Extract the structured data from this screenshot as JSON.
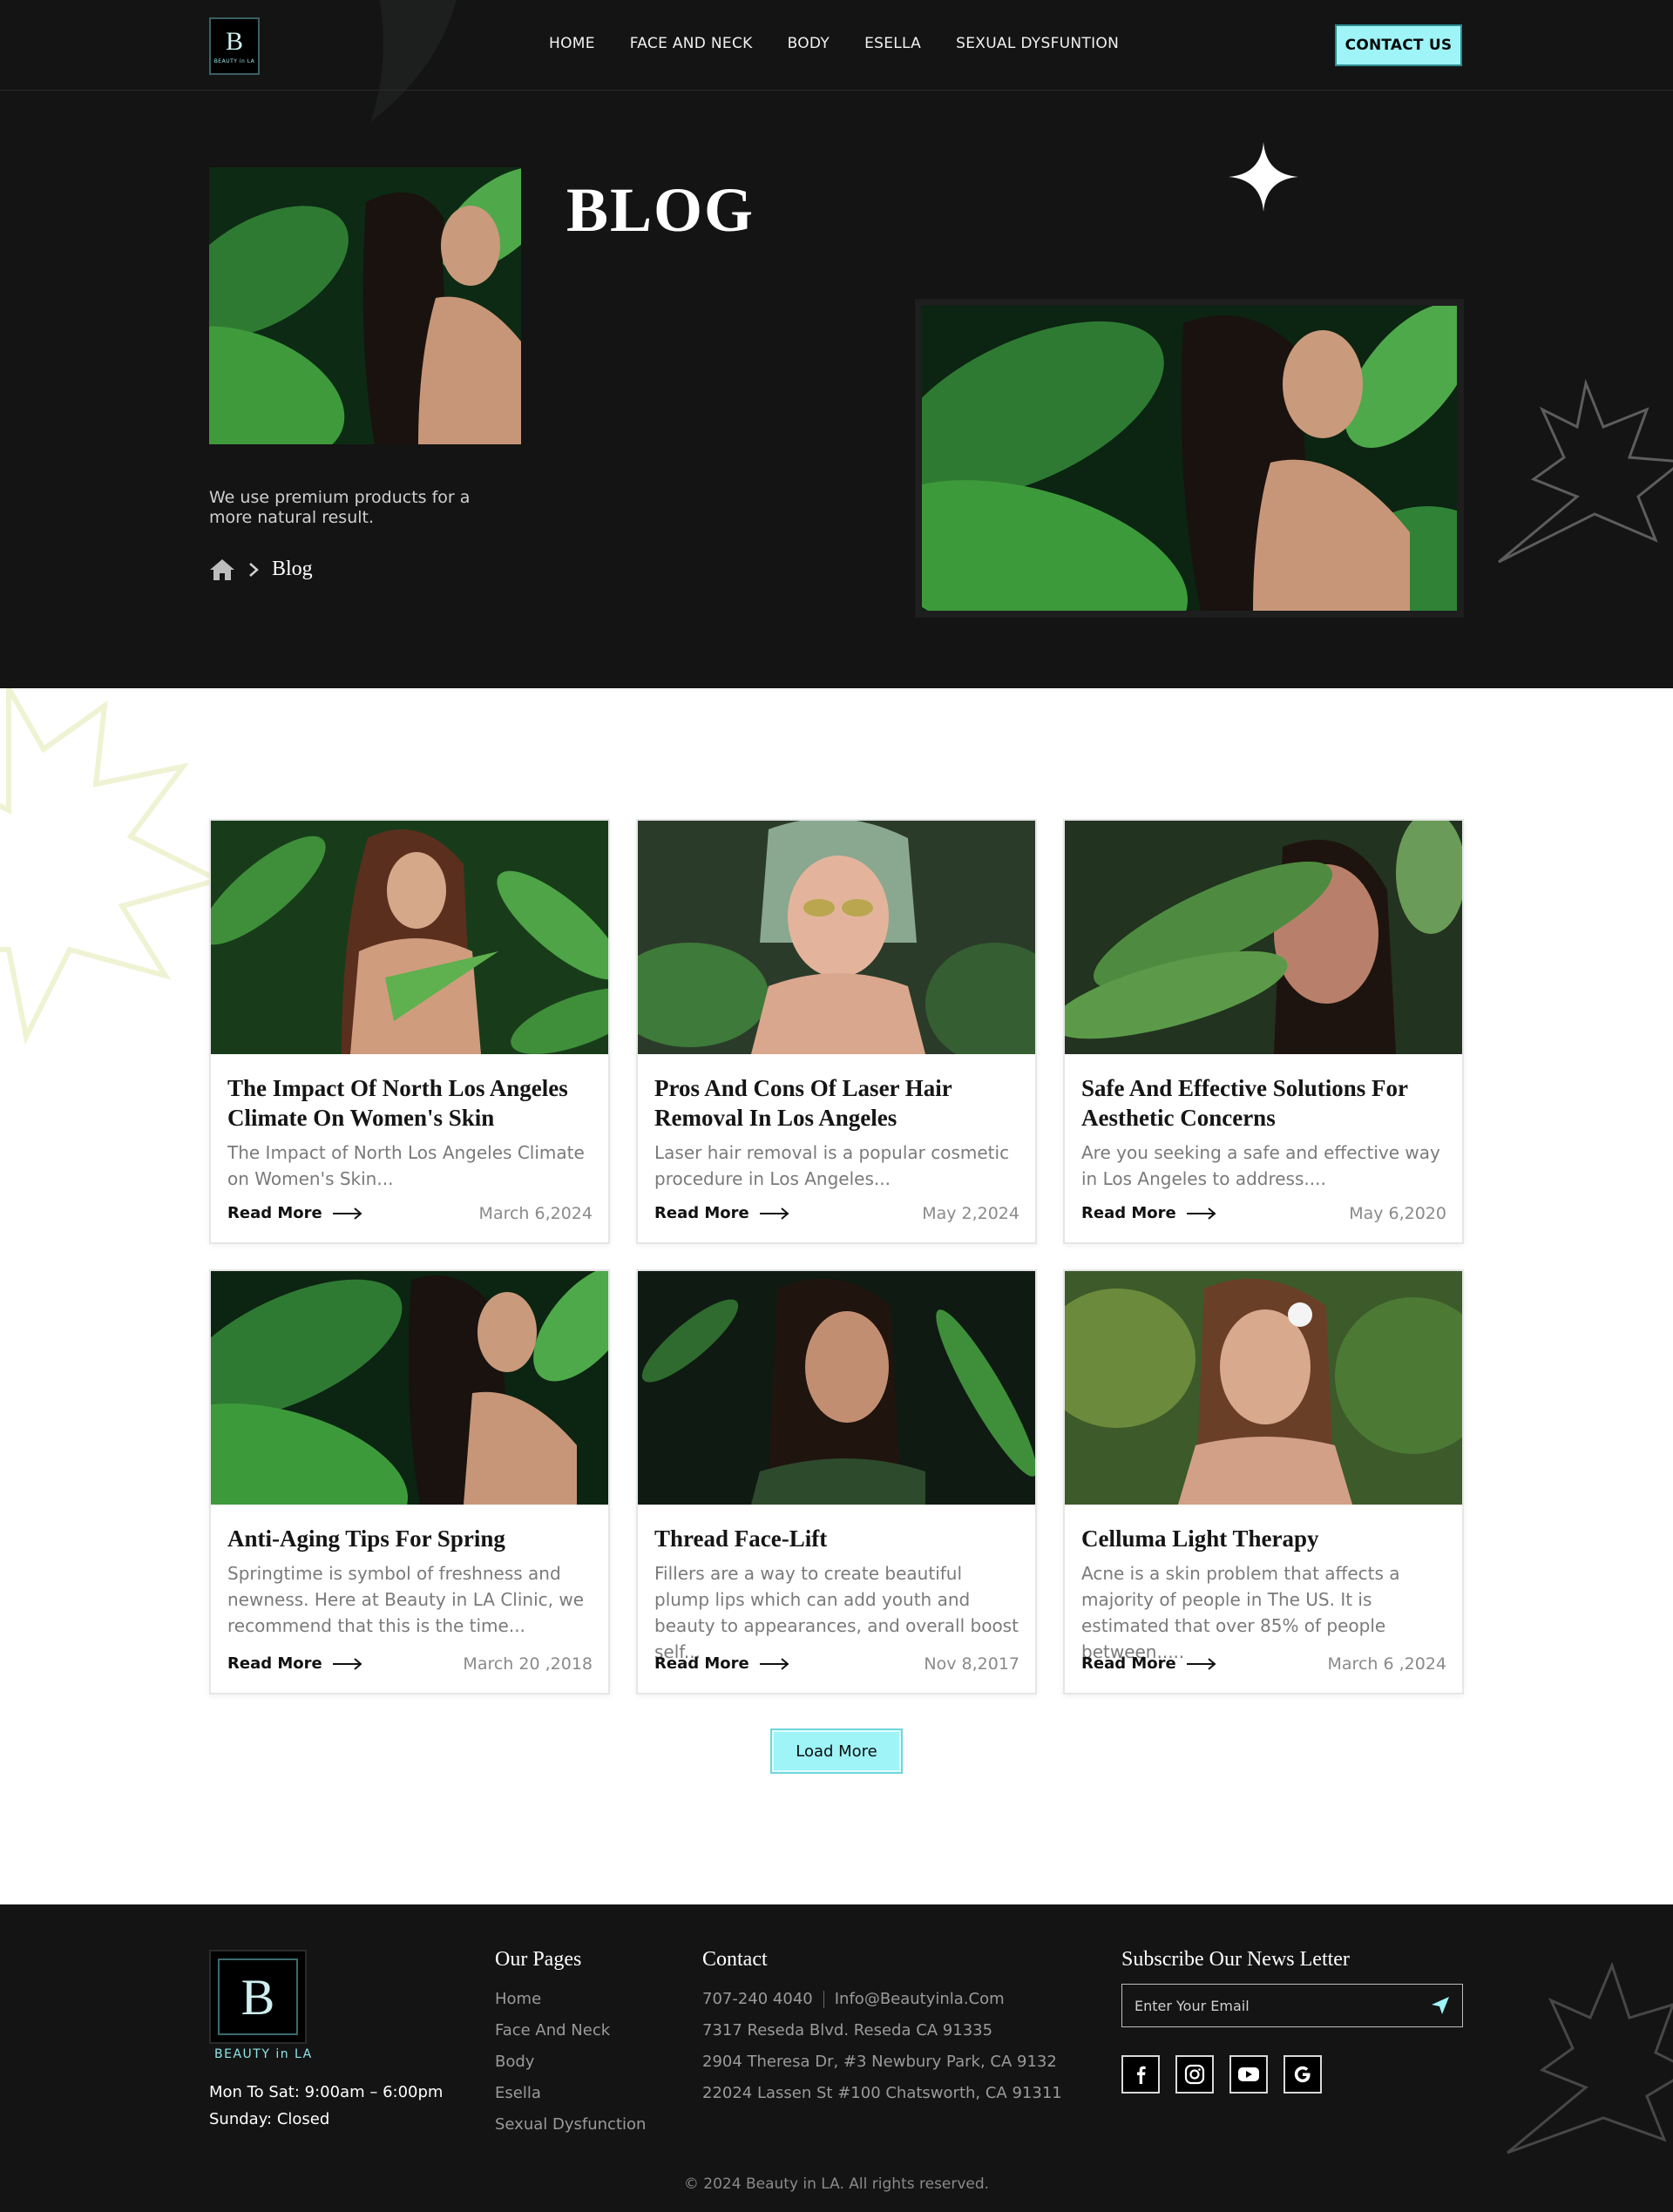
{
  "header": {
    "logo_text": "BEAUTY in LA",
    "nav": [
      "HOME",
      "FACE AND NECK",
      "BODY",
      "ESELLA",
      "SEXUAL DYSFUNTION"
    ],
    "contact_label": "CONTACT US"
  },
  "hero": {
    "title": "BLOG",
    "subtitle": "We use premium products for a more natural result.",
    "breadcrumb": {
      "home_icon": "home-icon",
      "separator_icon": "chevron-right-icon",
      "current": "Blog"
    }
  },
  "posts": [
    {
      "title": "The Impact Of North Los Angeles Climate On Women's Skin",
      "excerpt": "The Impact of North Los Angeles Climate on Women's Skin...",
      "read_more": "Read More",
      "date": "March 6,2024"
    },
    {
      "title": "Pros And Cons Of Laser Hair Removal In Los Angeles",
      "excerpt": "Laser hair removal is a popular cosmetic procedure in Los Angeles...",
      "read_more": "Read More",
      "date": "May 2,2024"
    },
    {
      "title": "Safe And Effective Solutions For Aesthetic Concerns",
      "excerpt": "Are you seeking a safe and effective way in Los Angeles to address....",
      "read_more": "Read More",
      "date": "May 6,2020"
    },
    {
      "title": "Anti-Aging Tips For Spring",
      "excerpt": "Springtime is symbol of freshness and newness. Here at  Beauty in LA Clinic, we recommend that this is the time...",
      "read_more": "Read More",
      "date": "March 20 ,2018"
    },
    {
      "title": "Thread Face-Lift",
      "excerpt": "Fillers are a way to create beautiful plump lips which can add youth and beauty to appearances, and overall boost self...",
      "read_more": "Read More",
      "date": "Nov 8,2017"
    },
    {
      "title": "Celluma Light Therapy",
      "excerpt": "Acne is a skin problem that affects a majority of people in The US. It is estimated that over 85% of people between.....",
      "read_more": "Read More",
      "date": "March 6 ,2024"
    }
  ],
  "load_more": "Load More",
  "footer": {
    "brand": "BEAUTY in LA",
    "hours_1": "Mon To Sat: 9:00am – 6:00pm",
    "hours_2": "Sunday: Closed",
    "pages_title": "Our Pages",
    "pages": [
      "Home",
      "Face And  Neck",
      "Body",
      "Esella",
      "Sexual Dysfunction"
    ],
    "contact_title": "Contact",
    "phone": "707-240 4040",
    "email": "Info@Beautyinla.Com",
    "addresses": [
      "7317 Reseda Blvd. Reseda CA 91335",
      "2904 Theresa Dr, #3 Newbury Park, CA 9132",
      "22024 Lassen St #100 Chatsworth, CA 91311"
    ],
    "newsletter_title": "Subscribe Our News Letter",
    "email_placeholder": "Enter Your Email",
    "socials": [
      "facebook-icon",
      "instagram-icon",
      "youtube-icon",
      "google-icon"
    ],
    "copyright": "© 2024 Beauty in LA. All rights reserved."
  },
  "colors": {
    "accent": "#9ef4f7",
    "dark": "#141414"
  }
}
